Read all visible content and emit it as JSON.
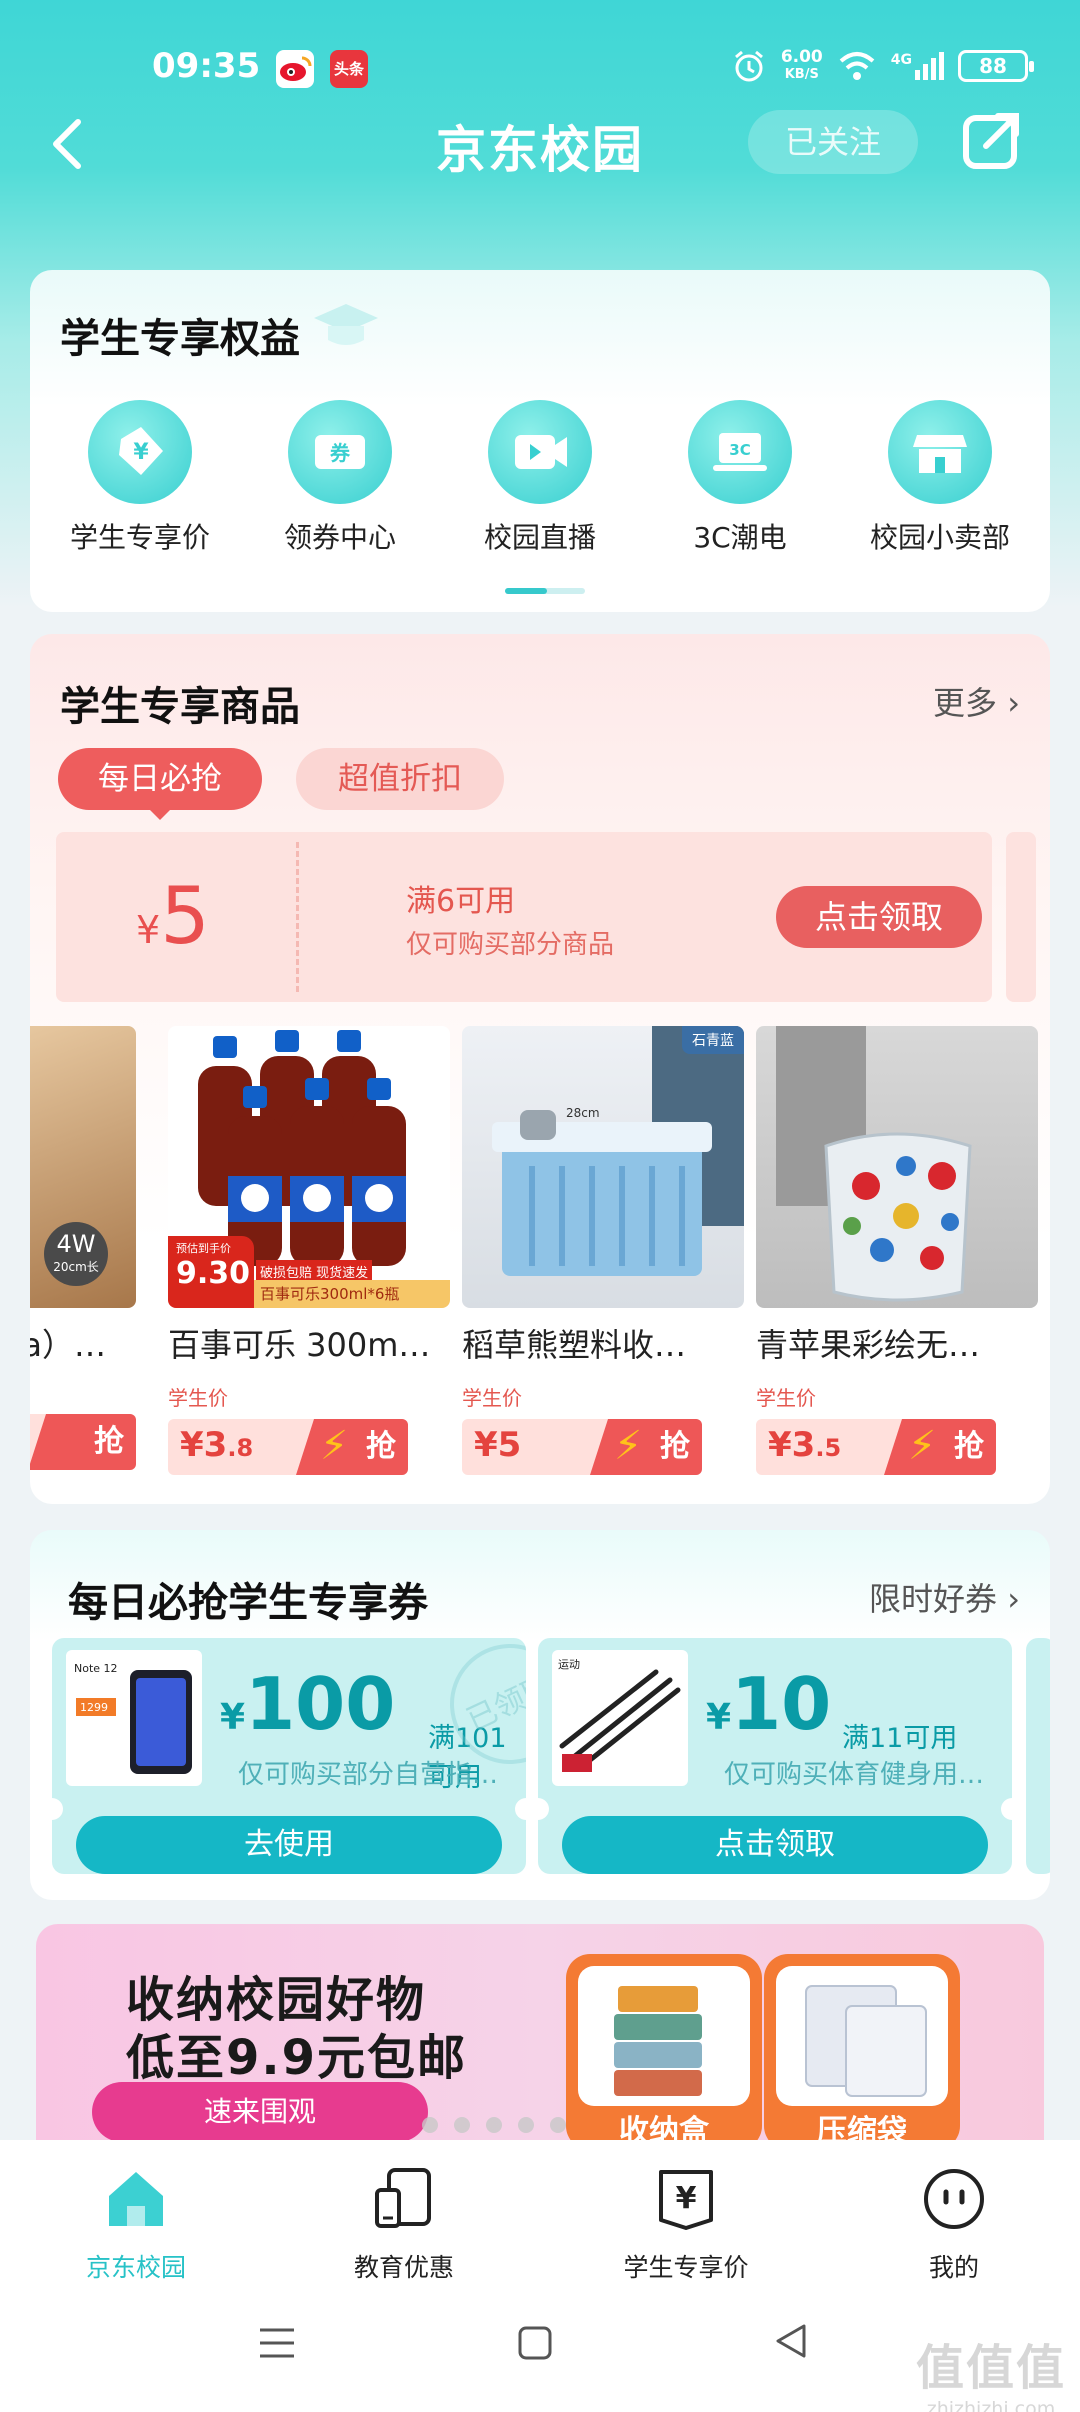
{
  "status_bar": {
    "time": "09:35",
    "app_icons": [
      "weibo-icon",
      "toutiao-icon"
    ],
    "toutiao_label": "头条",
    "net_speed": "6.00",
    "net_unit": "KB/S",
    "network": "4G",
    "battery": "88"
  },
  "header": {
    "title": "京东校园",
    "follow_label": "已关注"
  },
  "benefits": {
    "title": "学生专享权益",
    "items": [
      {
        "label": "学生专享价",
        "icon": "price-tag-icon",
        "glyph": "¥"
      },
      {
        "label": "领券中心",
        "icon": "coupon-icon",
        "glyph": "券"
      },
      {
        "label": "校园直播",
        "icon": "live-video-icon",
        "glyph": "▶"
      },
      {
        "label": "3C潮电",
        "icon": "laptop-3c-icon",
        "glyph": "3C"
      },
      {
        "label": "校园小卖部",
        "icon": "store-icon",
        "glyph": "▦"
      }
    ]
  },
  "products_section": {
    "title": "学生专享商品",
    "more": "更多 ›",
    "tabs": [
      "每日必抢",
      "超值折扣"
    ],
    "coupon": {
      "currency": "¥",
      "amount": "5",
      "condition": "满6可用",
      "description": "仅可购买部分商品",
      "button": "点击领取"
    },
    "items": [
      {
        "name": "a）…",
        "badge": "4W",
        "badge_sub": "20cm长",
        "buy": "抢"
      },
      {
        "name": "百事可乐 300m…",
        "tag": "学生价",
        "price_main": "¥3",
        "price_frac": ".8",
        "buy": "抢",
        "promo_top": "预估到手价",
        "promo_price": "9.30",
        "promo_text1": "破损包赔  现货速发",
        "promo_text2": "百事可乐300ml*6瓶"
      },
      {
        "name": "稻草熊塑料收…",
        "tag": "学生价",
        "price_main": "¥5",
        "price_frac": "",
        "buy": "抢",
        "img_label": "石青蓝",
        "dim": "28cm"
      },
      {
        "name": "青苹果彩绘无…",
        "tag": "学生价",
        "price_main": "¥3",
        "price_frac": ".5",
        "buy": "抢"
      }
    ]
  },
  "daily_coupons": {
    "title": "每日必抢学生专享券",
    "more": "限时好券 ›",
    "items": [
      {
        "currency": "¥",
        "amount": "100",
        "condition": "满101可用",
        "description": "仅可购买部分自营指…",
        "button": "去使用",
        "stamp": "已领取"
      },
      {
        "currency": "¥",
        "amount": "10",
        "condition": "满11可用",
        "description": "仅可购买体育健身用…",
        "button": "点击领取"
      }
    ]
  },
  "banner": {
    "line1": "收纳校园好物",
    "line2": "低至9.9元包邮",
    "cta": "速来围观",
    "tiles": [
      "收纳盒",
      "压缩袋"
    ]
  },
  "tab_bar": {
    "items": [
      {
        "label": "京东校园",
        "icon": "home-icon",
        "active": true
      },
      {
        "label": "教育优惠",
        "icon": "devices-icon",
        "active": false
      },
      {
        "label": "学生专享价",
        "icon": "yen-tag-icon",
        "active": false
      },
      {
        "label": "我的",
        "icon": "profile-face-icon",
        "active": false
      }
    ]
  },
  "watermark": {
    "big": "值值值",
    "small": "zhizhizhi.com"
  },
  "colors": {
    "accent": "#3fd6d6",
    "red": "#ee5d5d",
    "teal_button": "#15b7c6"
  }
}
